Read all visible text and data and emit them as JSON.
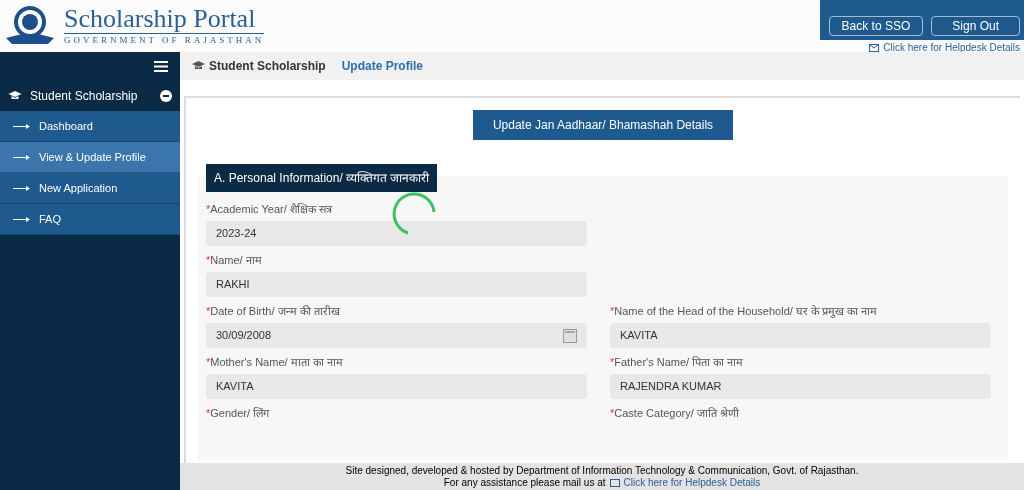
{
  "header": {
    "title": "Scholarship Portal",
    "subtitle": "GOVERNMENT OF RAJASTHAN",
    "buttons": [
      "Back to SSO",
      "Sign Out"
    ],
    "helpdesk_link": "Click here for Helpdesk Details"
  },
  "breadcrumb": [
    {
      "label": "Student Scholarship",
      "selected": false
    },
    {
      "label": "Update Profile",
      "selected": true
    }
  ],
  "sidebar": {
    "group": {
      "label": "Student Scholarship",
      "expanded": true,
      "children": [
        {
          "label": "Dashboard",
          "selected": false
        },
        {
          "label": "View & Update Profile",
          "selected": true
        },
        {
          "label": "New Application",
          "selected": false
        },
        {
          "label": "FAQ",
          "selected": false
        }
      ]
    }
  },
  "update_button": "Update Jan Aadhaar/ Bhamashah Details",
  "section": {
    "title": "A. Personal Information/ व्यक्तिगत जानकारी",
    "loading": true,
    "rows": [
      [
        {
          "marker": "*",
          "label": "Academic Year/ शैक्षिक सत्र",
          "value": "2023-24"
        }
      ],
      [
        {
          "marker": "*",
          "label": "Name/ नाम",
          "value": "RAKHI"
        }
      ],
      [
        {
          "marker": "*",
          "label": "Date of Birth/ जन्म की तारीख",
          "value": "30/09/2008",
          "kind": "date"
        },
        {
          "marker": "*",
          "label": "Name of the Head of the Household/ घर के प्रमुख का नाम",
          "value": "KAVITA"
        }
      ],
      [
        {
          "marker": "*",
          "label": "Mother's Name/ माता का नाम",
          "value": "KAVITA"
        },
        {
          "marker": "*",
          "label": "Father's Name/ पिता का नाम",
          "value": "RAJENDRA KUMAR"
        }
      ],
      [
        {
          "marker": "*",
          "label": "Gender/ लिंग"
        },
        {
          "marker": "*",
          "label": "Caste Category/ जाति श्रेणी"
        }
      ]
    ]
  },
  "footer": {
    "line1": "Site designed, developed & hosted by Department of Information Technology & Communication, Govt. of Rajasthan.",
    "line2": "For any assistance please mail us at",
    "link": "Click here for Helpdesk Details"
  }
}
